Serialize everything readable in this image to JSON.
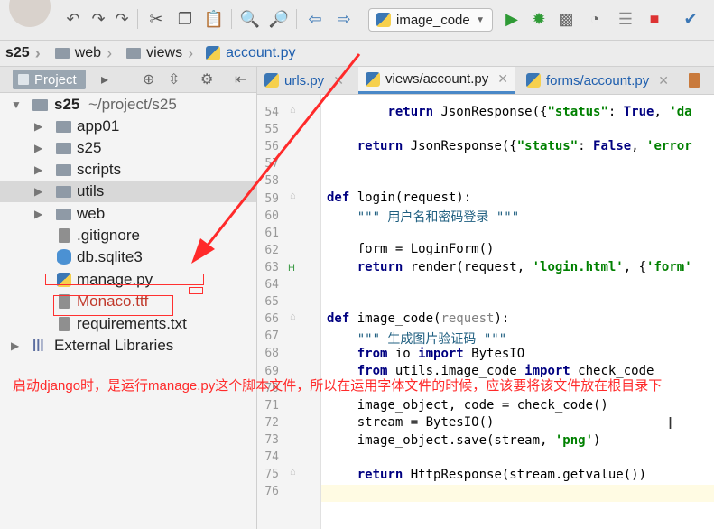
{
  "toolbar": {
    "run_config": "image_code"
  },
  "breadcrumb": [
    "s25",
    "web",
    "views",
    "account.py"
  ],
  "sidebar": {
    "project_tab": "Project",
    "tree": [
      {
        "label": "s25",
        "path": "~/project/s25"
      },
      {
        "label": "app01"
      },
      {
        "label": "s25"
      },
      {
        "label": "scripts"
      },
      {
        "label": "utils"
      },
      {
        "label": "web"
      },
      {
        "label": ".gitignore"
      },
      {
        "label": "db.sqlite3"
      },
      {
        "label": "manage.py"
      },
      {
        "label": "Monaco.ttf"
      },
      {
        "label": "requirements.txt"
      },
      {
        "label": "External Libraries"
      }
    ]
  },
  "tabs": [
    {
      "label": "urls.py"
    },
    {
      "label": "views/account.py"
    },
    {
      "label": "forms/account.py"
    }
  ],
  "line_numbers": [
    "54",
    "55",
    "56",
    "57",
    "58",
    "59",
    "60",
    "61",
    "62",
    "63",
    "64",
    "65",
    "66",
    "67",
    "68",
    "69",
    "70",
    "71",
    "72",
    "73",
    "74",
    "75",
    "76"
  ],
  "annotation": "启动django时，是运行manage.py这个脚本文件，所以在运用字体文件的时候，应该要将该文件放在根目录下",
  "colors": {
    "annotation": "#ff2a2a",
    "keyword": "#000080",
    "string": "#008000"
  }
}
